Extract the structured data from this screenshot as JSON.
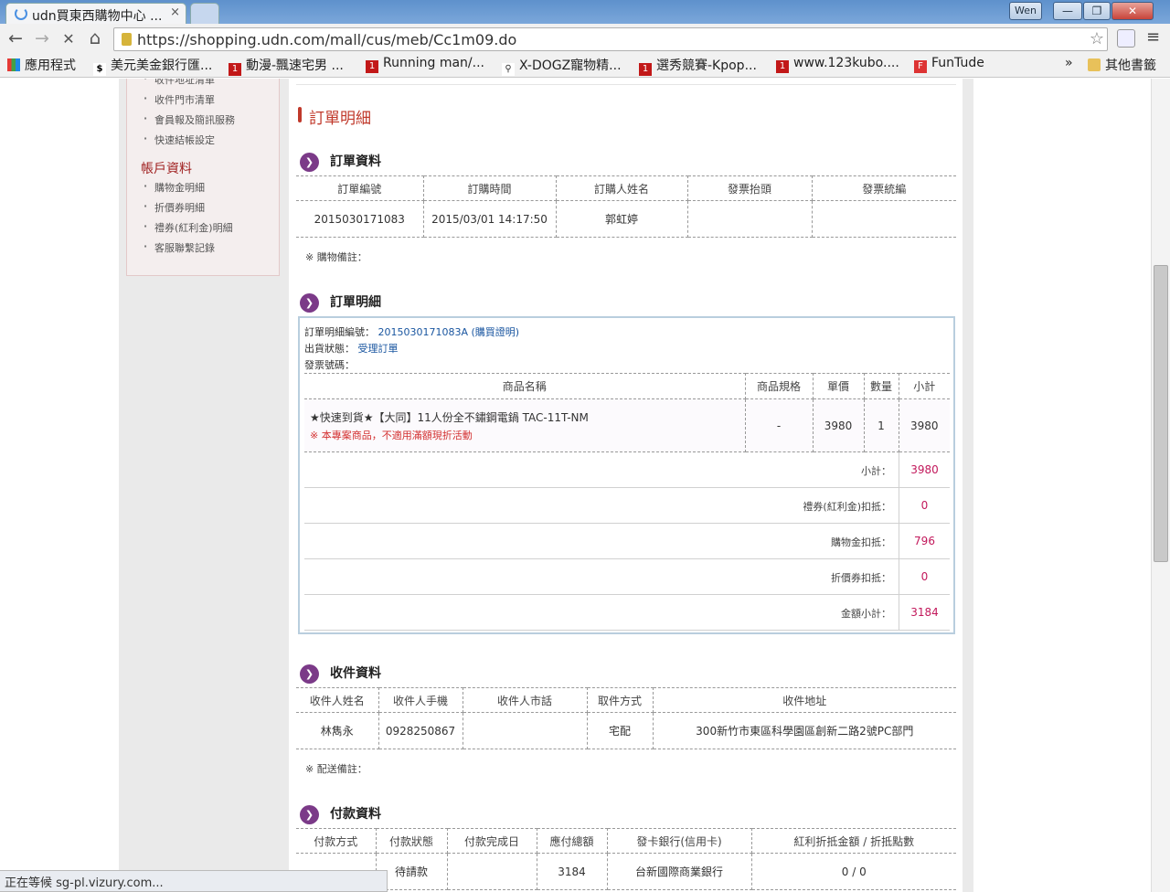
{
  "browser": {
    "tab_title": "udn買東西購物中心 ...",
    "tab_close": "×",
    "user_name": "Wen",
    "min": "—",
    "max": "❐",
    "close": "✕",
    "back": "←",
    "forward": "→",
    "reload": "✕",
    "home": "⌂",
    "url": "https://shopping.udn.com/mall/cus/meb/Cc1m09.do",
    "star": "☆",
    "menu": "≡",
    "bookmarks": [
      "應用程式",
      "美元美金銀行匯...",
      "動漫-飄速宅男 ...",
      "Running man/...",
      "X-DOGZ寵物精...",
      "選秀競賽-Kpop...",
      "www.123kubo....",
      "FunTude"
    ],
    "bookmarks_more": "»",
    "other_bookmarks": "其他書籤",
    "status": "正在等候 sg-pl.vizury.com..."
  },
  "sidebar": {
    "links_top": [
      "收件地址清單",
      "收件門市清單",
      "會員報及簡訊服務",
      "快速結帳設定"
    ],
    "heading": "帳戶資料",
    "links_bottom": [
      "購物金明細",
      "折價券明細",
      "禮券(紅利金)明細",
      "客服聯繫記錄"
    ]
  },
  "page_title": "訂單明細",
  "order_info": {
    "title": "訂單資料",
    "headers": [
      "訂單編號",
      "訂購時間",
      "訂購人姓名",
      "發票抬頭",
      "發票統編"
    ],
    "order_no": "2015030171083",
    "order_time": "2015/03/01 14:17:50",
    "buyer": "郭虹婷",
    "invoice_title": "",
    "invoice_tax_id": "",
    "note_label": "※ 購物備註："
  },
  "order_detail": {
    "title": "訂單明細",
    "detail_no_label": "訂單明細編號：",
    "detail_no": "2015030171083A",
    "proof_link": "(購買證明)",
    "status_label": "出貨狀態：",
    "status": "受理訂單",
    "invoice_label": "發票號碼：",
    "headers": [
      "商品名稱",
      "商品規格",
      "單價",
      "數量",
      "小計"
    ],
    "item": {
      "name": "★快速到貨★【大同】11人份全不鏽鋼電鍋 TAC-11T-NM",
      "notice": "※ 本專案商品，不適用滿額現折活動",
      "spec": "-",
      "price": "3980",
      "qty": "1",
      "subtotal": "3980"
    },
    "summary": [
      {
        "label": "小計：",
        "value": "3980"
      },
      {
        "label": "禮券(紅利金)扣抵：",
        "value": "0"
      },
      {
        "label": "購物金扣抵：",
        "value": "796"
      },
      {
        "label": "折價券扣抵：",
        "value": "0"
      },
      {
        "label": "金額小計：",
        "value": "3184"
      }
    ]
  },
  "recipient": {
    "title": "收件資料",
    "headers": [
      "收件人姓名",
      "收件人手機",
      "收件人市話",
      "取件方式",
      "收件地址"
    ],
    "name": "林雋永",
    "mobile": "0928250867",
    "phone": "",
    "method": "宅配",
    "address": "300新竹市東區科學園區創新二路2號PC部門",
    "note_label": "※ 配送備註："
  },
  "payment": {
    "title": "付款資料",
    "headers": [
      "付款方式",
      "付款狀態",
      "付款完成日",
      "應付總額",
      "發卡銀行(信用卡)",
      "紅利折抵金額 / 折抵點數"
    ],
    "method": "",
    "status": "待請款",
    "done_date": "",
    "amount": "3184",
    "bank": "台新國際商業銀行",
    "bonus": "0 / 0"
  }
}
